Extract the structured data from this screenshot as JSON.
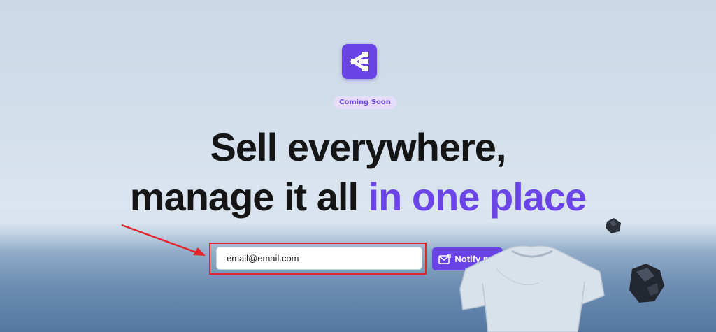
{
  "badge": {
    "label": "Coming Soon"
  },
  "headline": {
    "line1": "Sell everywhere,",
    "line2_prefix": "manage it all ",
    "line2_accent": "in one place"
  },
  "email_form": {
    "value": "email@email.com",
    "button_label": "Notify me"
  },
  "colors": {
    "accent": "#6a43e6",
    "highlight_border": "#e3262c",
    "headline_text": "#151515"
  },
  "icons": {
    "logo": "share-nodes-logo",
    "button": "mail-icon"
  }
}
